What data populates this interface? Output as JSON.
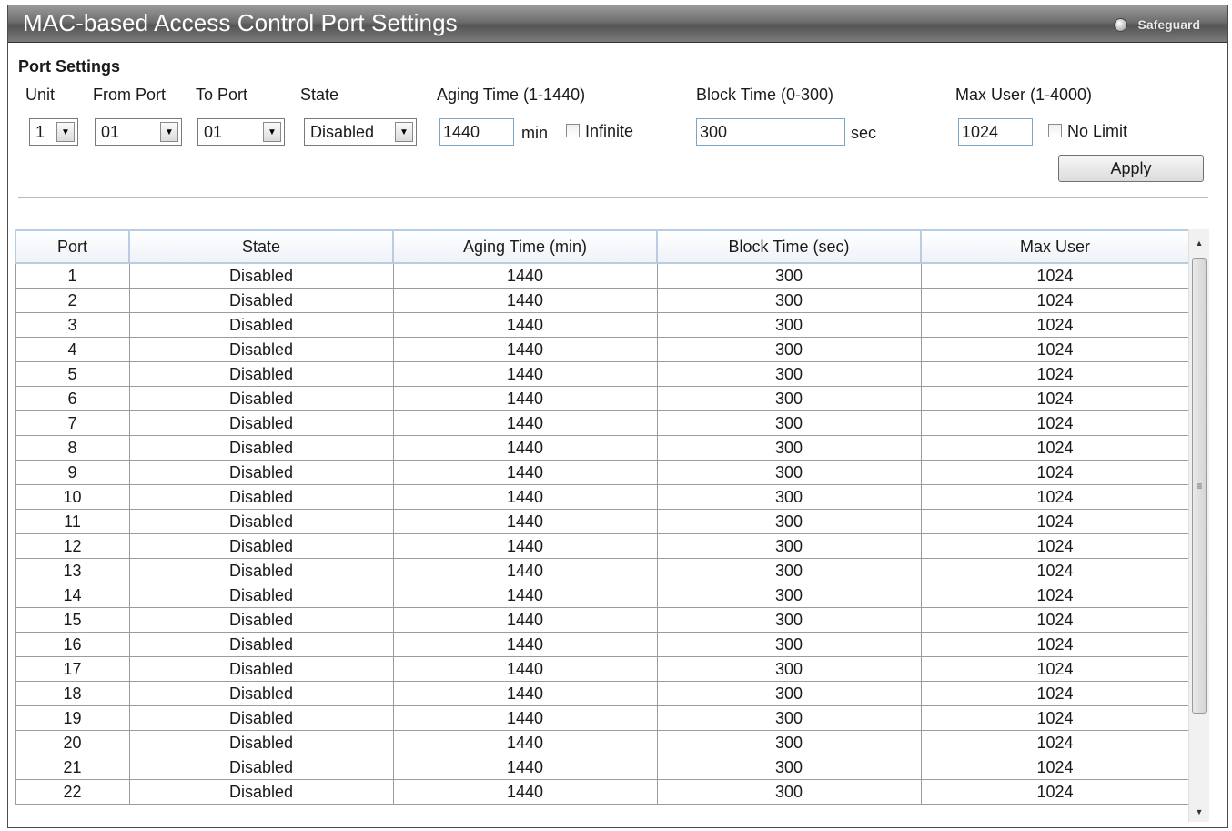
{
  "window": {
    "title": "MAC-based Access Control Port Settings",
    "safeguard_label": "Safeguard"
  },
  "port_settings": {
    "section_title": "Port Settings",
    "labels": {
      "unit": "Unit",
      "from_port": "From Port",
      "to_port": "To Port",
      "state": "State",
      "aging_time": "Aging Time (1-1440)",
      "block_time": "Block Time (0-300)",
      "max_user": "Max User (1-4000)"
    },
    "unit_value": "1",
    "from_port_value": "01",
    "to_port_value": "01",
    "state_value": "Disabled",
    "aging_time_value": "1440",
    "aging_unit": "min",
    "infinite_label": "Infinite",
    "infinite_checked": false,
    "block_time_value": "300",
    "block_unit": "sec",
    "max_user_value": "1024",
    "no_limit_label": "No Limit",
    "no_limit_checked": false,
    "apply_label": "Apply"
  },
  "table": {
    "columns": [
      "Port",
      "State",
      "Aging Time (min)",
      "Block Time (sec)",
      "Max User"
    ],
    "rows": [
      [
        "1",
        "Disabled",
        "1440",
        "300",
        "1024"
      ],
      [
        "2",
        "Disabled",
        "1440",
        "300",
        "1024"
      ],
      [
        "3",
        "Disabled",
        "1440",
        "300",
        "1024"
      ],
      [
        "4",
        "Disabled",
        "1440",
        "300",
        "1024"
      ],
      [
        "5",
        "Disabled",
        "1440",
        "300",
        "1024"
      ],
      [
        "6",
        "Disabled",
        "1440",
        "300",
        "1024"
      ],
      [
        "7",
        "Disabled",
        "1440",
        "300",
        "1024"
      ],
      [
        "8",
        "Disabled",
        "1440",
        "300",
        "1024"
      ],
      [
        "9",
        "Disabled",
        "1440",
        "300",
        "1024"
      ],
      [
        "10",
        "Disabled",
        "1440",
        "300",
        "1024"
      ],
      [
        "11",
        "Disabled",
        "1440",
        "300",
        "1024"
      ],
      [
        "12",
        "Disabled",
        "1440",
        "300",
        "1024"
      ],
      [
        "13",
        "Disabled",
        "1440",
        "300",
        "1024"
      ],
      [
        "14",
        "Disabled",
        "1440",
        "300",
        "1024"
      ],
      [
        "15",
        "Disabled",
        "1440",
        "300",
        "1024"
      ],
      [
        "16",
        "Disabled",
        "1440",
        "300",
        "1024"
      ],
      [
        "17",
        "Disabled",
        "1440",
        "300",
        "1024"
      ],
      [
        "18",
        "Disabled",
        "1440",
        "300",
        "1024"
      ],
      [
        "19",
        "Disabled",
        "1440",
        "300",
        "1024"
      ],
      [
        "20",
        "Disabled",
        "1440",
        "300",
        "1024"
      ],
      [
        "21",
        "Disabled",
        "1440",
        "300",
        "1024"
      ],
      [
        "22",
        "Disabled",
        "1440",
        "300",
        "1024"
      ]
    ]
  },
  "icons": {
    "dropdown": "chevron-down-icon",
    "scroll_up": "arrow-up-icon",
    "scroll_down": "arrow-down-icon",
    "safeguard": "radio-dot-icon"
  },
  "colors": {
    "header_border": "#b7cde1",
    "input_border": "#7aa6c8",
    "titlebar": "#6e6e6e"
  }
}
